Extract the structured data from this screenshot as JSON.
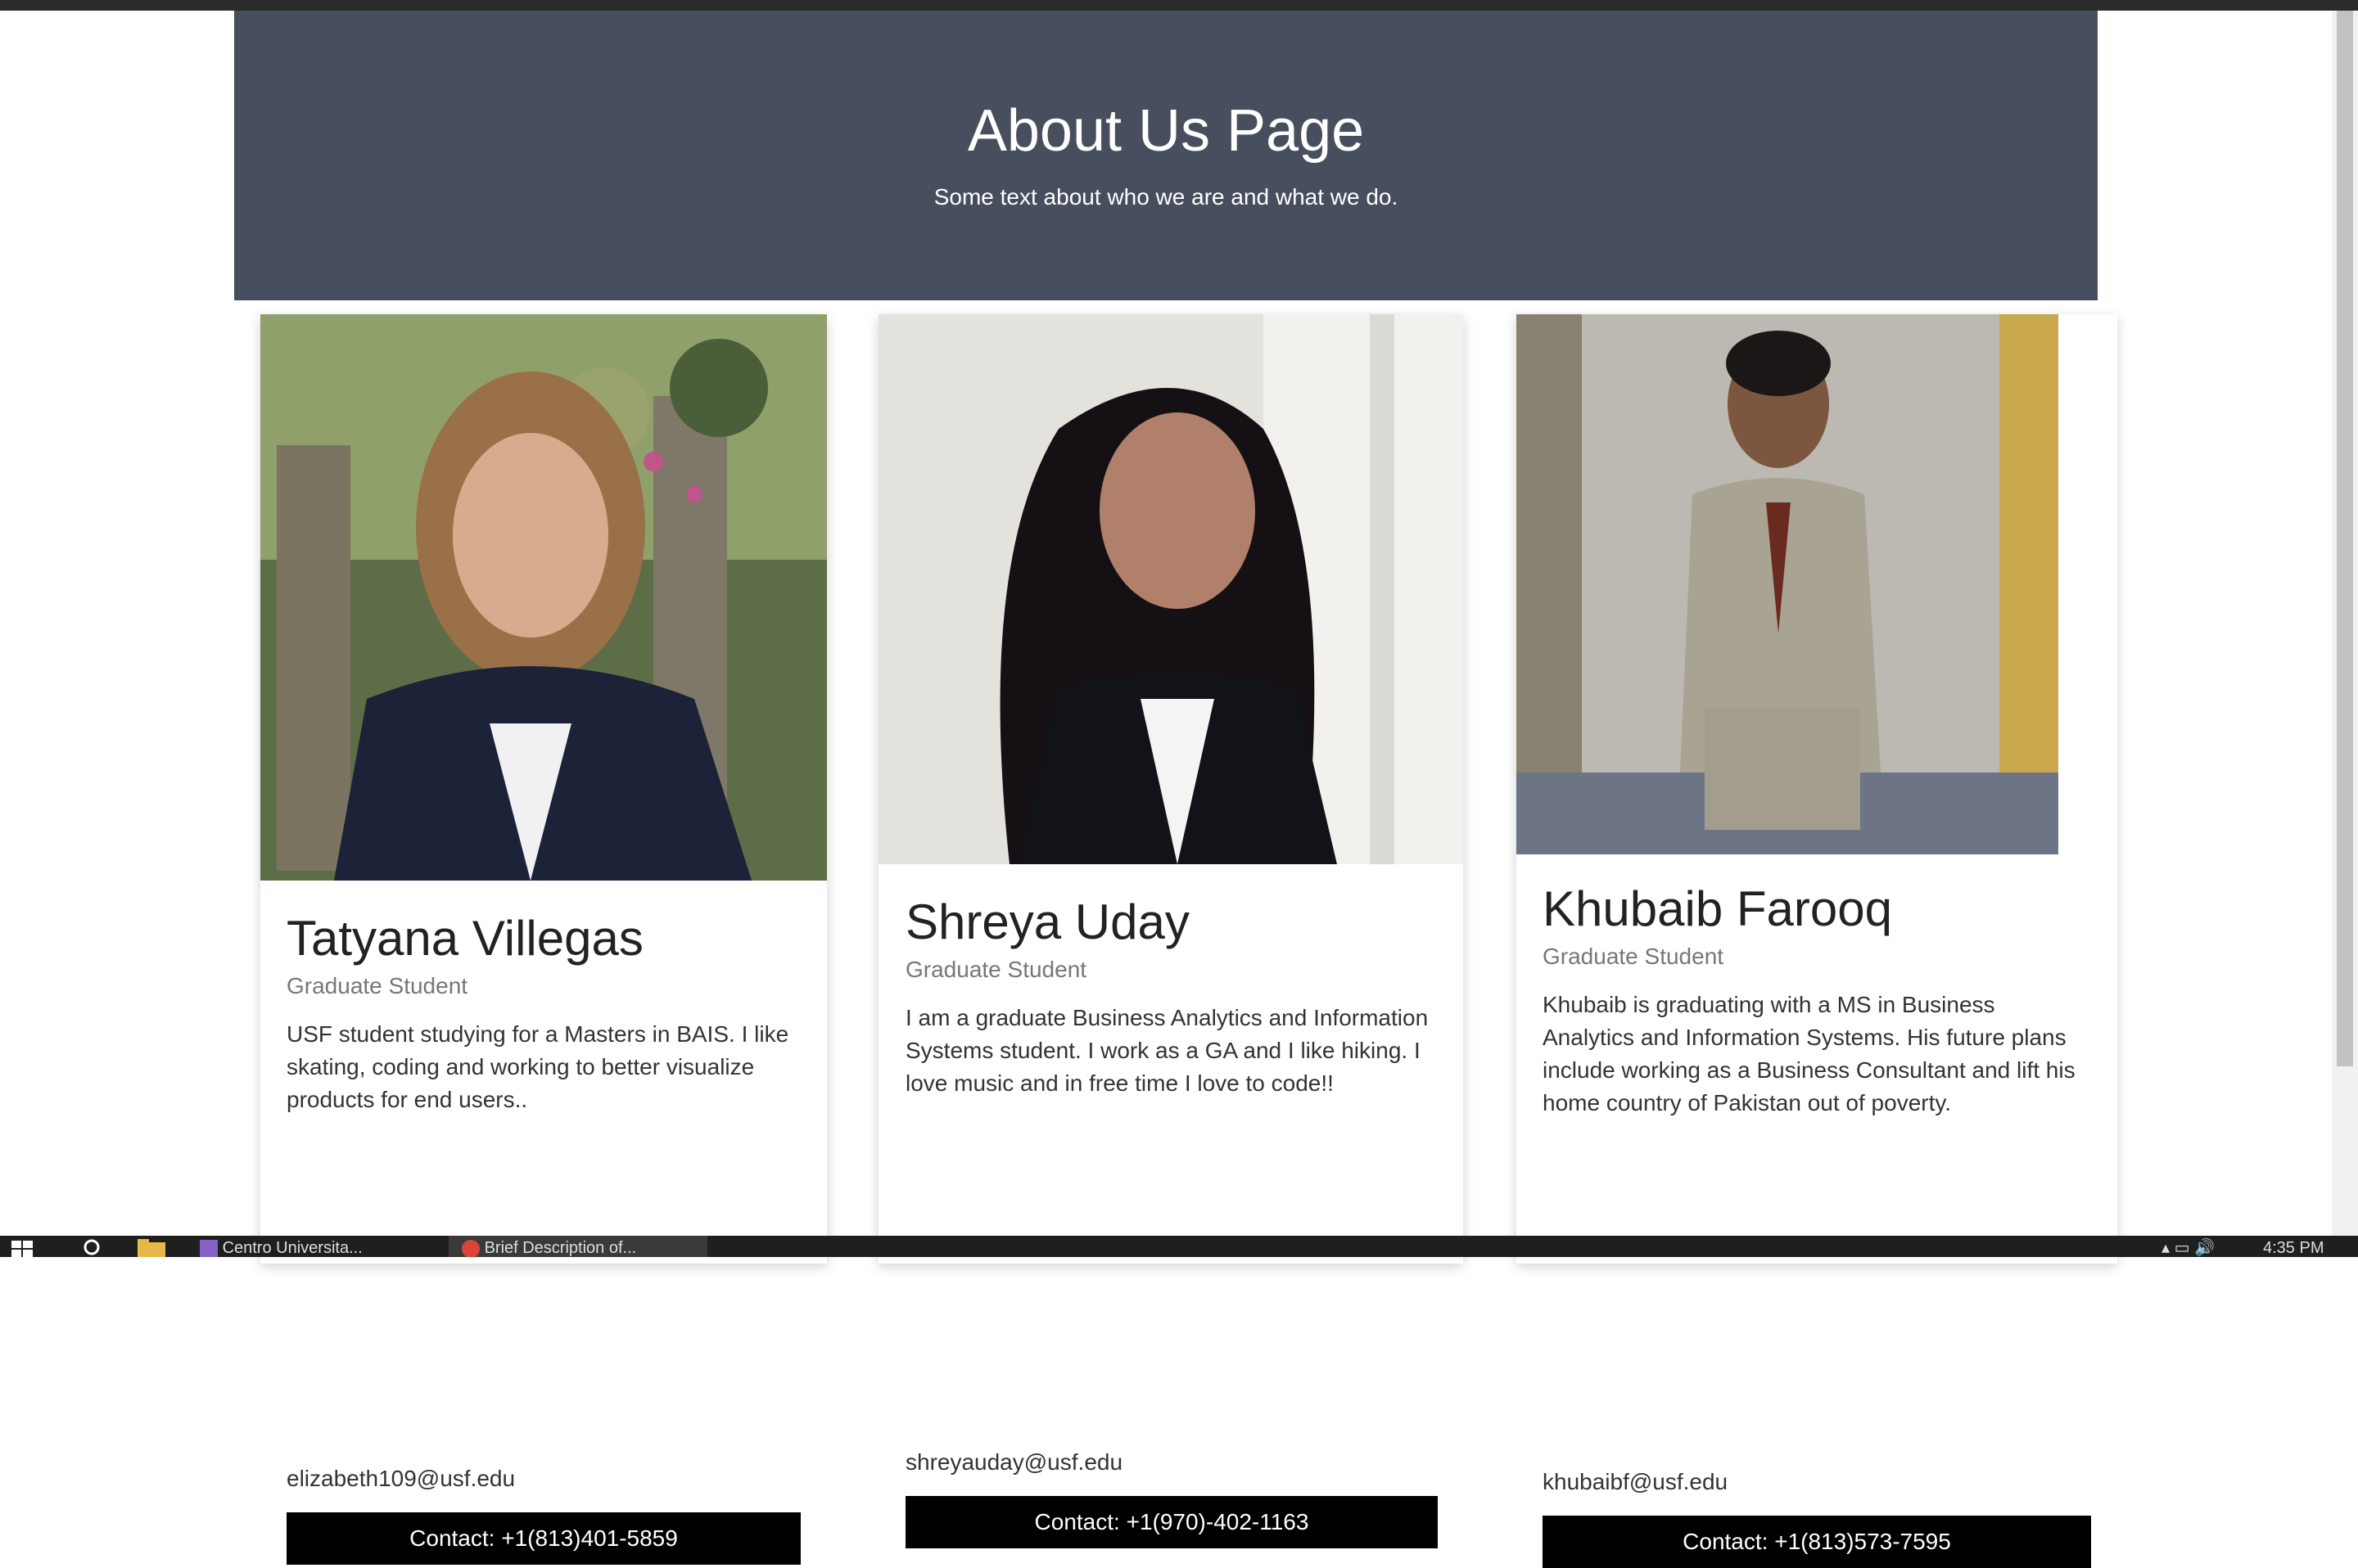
{
  "header": {
    "title": "About Us Page",
    "subtitle": "Some text about who we are and what we do."
  },
  "members": [
    {
      "name": "Tatyana Villegas",
      "role": "Graduate Student",
      "bio": "USF student studying for a Masters in BAIS. I like skating, coding and working to better visualize products for end users..",
      "email": "elizabeth109@usf.edu",
      "contact": "Contact: +1(813)401-5859"
    },
    {
      "name": "Shreya Uday",
      "role": "Graduate Student",
      "bio": "I am a graduate Business Analytics and Information Systems student. I work as a GA and I like hiking. I love music and in free time I love to code!!",
      "email": "shreyauday@usf.edu",
      "contact": "Contact: +1(970)-402-1163"
    },
    {
      "name": "Khubaib Farooq",
      "role": "Graduate Student",
      "bio": "Khubaib is graduating with a MS in Business Analytics and Information Systems. His future plans include working as a Business Consultant and lift his home country of Pakistan out of poverty.",
      "email": "khubaibf@usf.edu",
      "contact": "Contact: +1(813)573-7595"
    }
  ],
  "taskbar": {
    "app1": "Centro Universita...",
    "app2": "Brief Description of...",
    "clock": "4:35 PM"
  },
  "colors": {
    "hero_bg": "#474e5d",
    "button_bg": "#000000"
  }
}
